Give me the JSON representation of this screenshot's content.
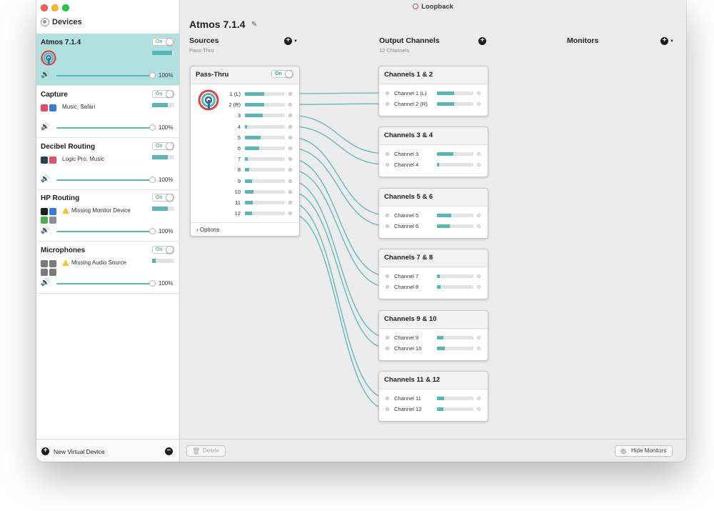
{
  "window": {
    "title": "Loopback"
  },
  "sidebar": {
    "header": "Devices",
    "devices": [
      {
        "name": "Atmos 7.1.4",
        "toggle": "On",
        "sources": "",
        "warning": false,
        "meter": 0.9,
        "volume": "100%",
        "selected": true
      },
      {
        "name": "Capture",
        "toggle": "On",
        "sources": "Music, Safari",
        "warning": false,
        "meter": 0.7,
        "volume": "100%",
        "selected": false
      },
      {
        "name": "Decibel Routing",
        "toggle": "On",
        "sources": "Logic Pro, Music",
        "warning": false,
        "meter": 0.7,
        "volume": "100%",
        "selected": false
      },
      {
        "name": "HP Routing",
        "toggle": "On",
        "sources": "Missing Monitor Device",
        "warning": true,
        "meter": 0.7,
        "volume": "100%",
        "selected": false
      },
      {
        "name": "Microphones",
        "toggle": "On",
        "sources": "Missing Audio Source",
        "warning": true,
        "meter": 0.15,
        "volume": "100%",
        "selected": false
      }
    ],
    "footer": {
      "new_device": "New Virtual Device"
    }
  },
  "main": {
    "device_title": "Atmos 7.1.4",
    "sources": {
      "title": "Sources",
      "subtitle": "Pass-Thru"
    },
    "outputs": {
      "title": "Output Channels",
      "subtitle": "12 Channels"
    },
    "monitors": {
      "title": "Monitors"
    },
    "passthru": {
      "title": "Pass-Thru",
      "toggle": "On",
      "channels": [
        {
          "label": "1 (L)",
          "level": 0.48
        },
        {
          "label": "2 (R)",
          "level": 0.48
        },
        {
          "label": "3",
          "level": 0.45
        },
        {
          "label": "4",
          "level": 0.05
        },
        {
          "label": "5",
          "level": 0.4
        },
        {
          "label": "6",
          "level": 0.36
        },
        {
          "label": "7",
          "level": 0.07
        },
        {
          "label": "8",
          "level": 0.1
        },
        {
          "label": "9",
          "level": 0.18
        },
        {
          "label": "10",
          "level": 0.22
        },
        {
          "label": "11",
          "level": 0.2
        },
        {
          "label": "12",
          "level": 0.17
        }
      ],
      "options": "Options"
    },
    "output_cards": [
      {
        "title": "Channels 1 & 2",
        "channels": [
          {
            "label": "Channel 1 (L)",
            "level": 0.48
          },
          {
            "label": "Channel 2 (R)",
            "level": 0.48
          }
        ]
      },
      {
        "title": "Channels 3 & 4",
        "channels": [
          {
            "label": "Channel 3",
            "level": 0.45
          },
          {
            "label": "Channel 4",
            "level": 0.05
          }
        ]
      },
      {
        "title": "Channels 5 & 6",
        "channels": [
          {
            "label": "Channel 5",
            "level": 0.4
          },
          {
            "label": "Channel 6",
            "level": 0.36
          }
        ]
      },
      {
        "title": "Channels 7 & 8",
        "channels": [
          {
            "label": "Channel 7",
            "level": 0.07
          },
          {
            "label": "Channel 8",
            "level": 0.1
          }
        ]
      },
      {
        "title": "Channels 9 & 10",
        "channels": [
          {
            "label": "Channel 9",
            "level": 0.18
          },
          {
            "label": "Channel 10",
            "level": 0.22
          }
        ]
      },
      {
        "title": "Channels 11 & 12",
        "channels": [
          {
            "label": "Channel 11",
            "level": 0.2
          },
          {
            "label": "Channel 12",
            "level": 0.17
          }
        ]
      }
    ],
    "bottom": {
      "delete": "Delete",
      "hide_monitors": "Hide Monitors"
    }
  },
  "colors": {
    "accent": "#58b6b6",
    "selection": "#b2e0e1",
    "wire": "#5fb6b6",
    "warning": "#f4c430"
  }
}
